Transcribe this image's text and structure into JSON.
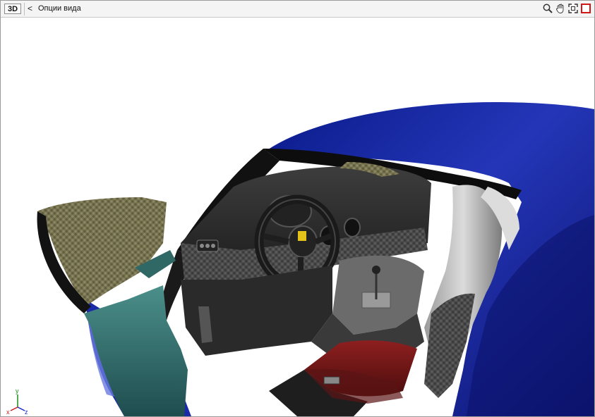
{
  "toolbar": {
    "mode_label": "3D",
    "back_label": "<",
    "title": "Опции вида",
    "tools": [
      {
        "icon": "zoom-icon"
      },
      {
        "icon": "pan-hand-icon"
      },
      {
        "icon": "fit-view-icon"
      },
      {
        "icon": "stop-icon"
      }
    ]
  },
  "viewport": {
    "axes": {
      "x_label": "x",
      "y_label": "y",
      "z_label": "z"
    },
    "colors": {
      "body_blue": "#1c2aa8",
      "frame_teal": "#3a7b7b",
      "carbon": "#4b4b4b",
      "seat_red": "#7a1a1a",
      "background": "#ffffff"
    }
  }
}
